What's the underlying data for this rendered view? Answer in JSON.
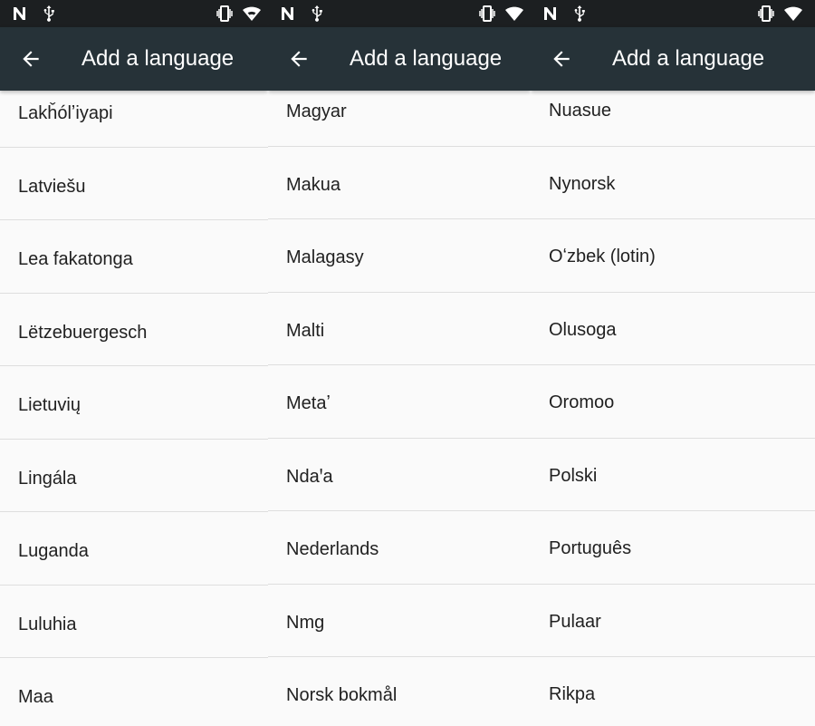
{
  "panels": [
    {
      "title": "Add a language",
      "languages": [
        "Lakȟólʼiyapi",
        "Latviešu",
        "Lea fakatonga",
        "Lëtzebuergesch",
        "Lietuvių",
        "Lingála",
        "Luganda",
        "Luluhia",
        "Maa"
      ]
    },
    {
      "title": "Add a language",
      "languages": [
        "Magyar",
        "Makua",
        "Malagasy",
        "Malti",
        "Metaʼ",
        "Ndaꞌa",
        "Nederlands",
        "Nmg",
        "Norsk bokmål"
      ]
    },
    {
      "title": "Add a language",
      "languages": [
        "Nuasue",
        "Nynorsk",
        "Oʻzbek (lotin)",
        "Olusoga",
        "Oromoo",
        "Polski",
        "Português",
        "Pulaar",
        "Rikpa"
      ]
    }
  ],
  "icons": {
    "status_left": [
      "notification-n-icon",
      "usb-icon"
    ],
    "status_right": [
      "vibrate-icon",
      "wifi-icon"
    ],
    "back": "arrow-back-icon"
  },
  "colors": {
    "status_bar": "#1c1f21",
    "app_bar": "#263238",
    "background": "#fafafa",
    "divider": "#dedede",
    "text": "#212121"
  }
}
